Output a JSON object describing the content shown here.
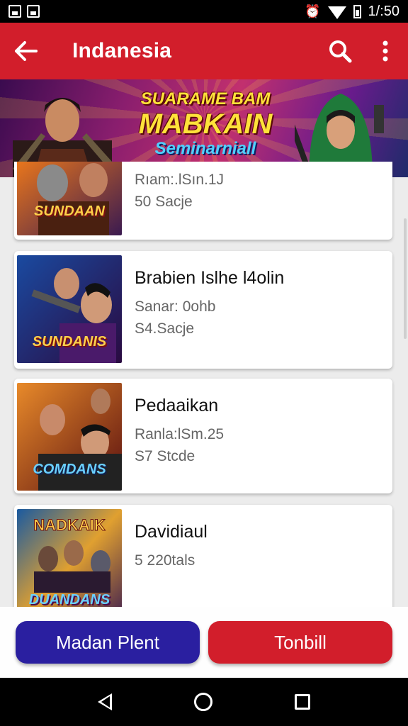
{
  "status_bar": {
    "time": "1/:50"
  },
  "app_bar": {
    "title": "Indanesia"
  },
  "banner": {
    "line1": "SUARAME BAM",
    "line2": "MABKAIN",
    "line3": "Seminarniall"
  },
  "items": [
    {
      "title": "",
      "meta1": "Rıam:.lSın.1J",
      "meta2": "50 Sacje",
      "thumb_text": "SUNDAAN"
    },
    {
      "title": "Brabien Islhe l4olin",
      "meta1": "Sanar: 0ohb",
      "meta2": "S4.Sacje",
      "thumb_text": "SUNDANIS"
    },
    {
      "title": "Pedaaikan",
      "meta1": "Ranla:lSm.25",
      "meta2": "S7 Stcde",
      "thumb_text": "COMDANS"
    },
    {
      "title": "Davidiaul",
      "meta1": "5 220tals",
      "meta2": "",
      "thumb_text": "DUANDANS"
    }
  ],
  "actions": {
    "primary": "Madan Plent",
    "secondary": "Tonbill"
  },
  "colors": {
    "app_bar": "#d21e2b",
    "primary_button": "#2a1fa0",
    "secondary_button": "#d21e2b"
  },
  "icons": [
    "back-arrow-icon",
    "search-icon",
    "more-vert-icon",
    "nav-back-icon",
    "nav-home-icon",
    "nav-recent-icon"
  ]
}
